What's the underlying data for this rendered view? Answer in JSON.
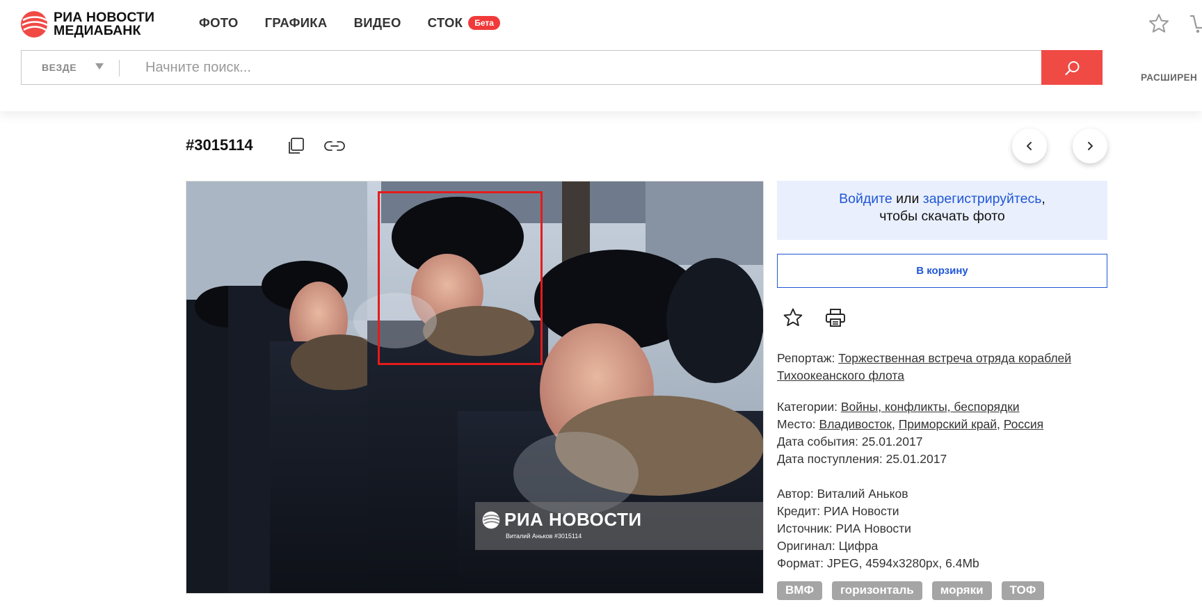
{
  "header": {
    "logo_line1": "РИА НОВОСТИ",
    "logo_line2": "МЕДИАБАНК",
    "nav": [
      "ФОТО",
      "ГРАФИКА",
      "ВИДЕО"
    ],
    "stok_label": "СТОК",
    "beta_label": "Бета",
    "advanced_label": "РАСШИРЕН"
  },
  "search": {
    "scope_label": "ВЕЗДЕ",
    "placeholder": "Начните поиск..."
  },
  "photo": {
    "id_label": "#3015114",
    "watermark_brand": "РИА НОВОСТИ",
    "watermark_credit": "Виталий Аньков #3015114"
  },
  "login": {
    "login_link": "Войдите",
    "or_text": " или ",
    "register_link": "зарегистрируйтесь",
    "comma": ",",
    "line2": "чтобы скачать фото"
  },
  "cart_button": "В корзину",
  "meta": {
    "report_label": "Репортаж: ",
    "report_value": "Торжественная встреча отряда кораблей Тихоокеанского флота",
    "categories_label": "Категории: ",
    "categories_value": "Войны, конфликты, беспорядки",
    "place_label": "Место: ",
    "place_values": [
      "Владивосток",
      "Приморский край",
      "Россия"
    ],
    "separator": ", ",
    "event_date": "Дата события: 25.01.2017",
    "received_date": "Дата поступления: 25.01.2017",
    "author": "Автор: Виталий Аньков",
    "credit": "Кредит: РИА Новости",
    "source": "Источник: РИА Новости",
    "original": "Оригинал: Цифра",
    "format": "Формат: JPEG, 4594x3280px, 6.4Mb"
  },
  "tags": [
    "ВМФ",
    "горизонталь",
    "моряки",
    "ТОФ"
  ],
  "colors": {
    "brand_red": "#f04a45",
    "link_blue": "#1f57d6",
    "highlight_red": "#e51b1b"
  }
}
